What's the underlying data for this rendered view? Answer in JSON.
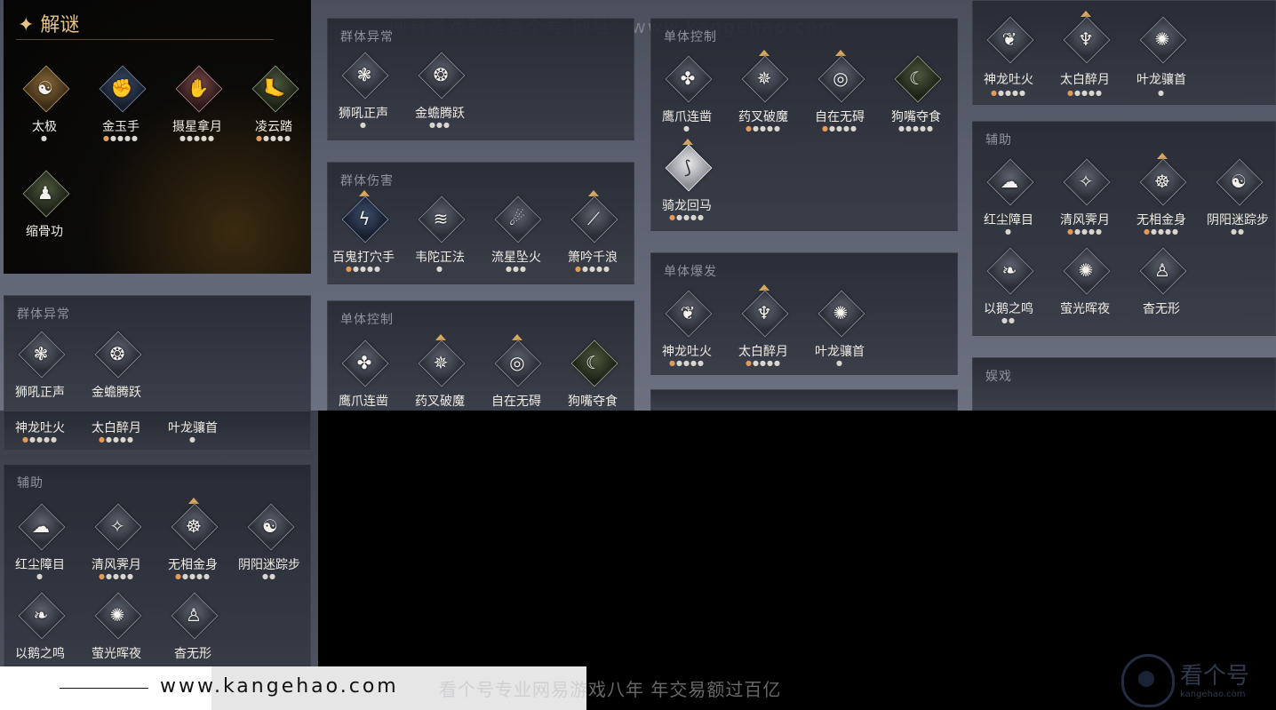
{
  "watermark_top": "网易游戏就选看个号   网址：www.kangehao.com",
  "header": {
    "title": "✦ 解谜"
  },
  "section_labels": {
    "group_abnormal": "群体异常",
    "group_damage": "群体伤害",
    "single_control": "单体控制",
    "single_burst": "单体爆发",
    "support": "辅助",
    "entertain": "娱戏"
  },
  "skills": {
    "taiji": {
      "name": "太极",
      "dots": "●",
      "orange": 0
    },
    "jinyushou": {
      "name": "金玉手",
      "dots": "●●●●●",
      "orange": 1
    },
    "zhexing": {
      "name": "摄星拿月",
      "dots": "●●●●●",
      "orange": 0
    },
    "lingyun": {
      "name": "凌云踏",
      "dots": "●●●●●",
      "orange": 1
    },
    "suogu": {
      "name": "缩骨功",
      "dots": "",
      "orange": 0
    },
    "shihou": {
      "name": "狮吼正声",
      "dots": "●",
      "orange": 0
    },
    "jinchan": {
      "name": "金蟾腾跃",
      "dots": "●●●",
      "orange": 0
    },
    "baigui": {
      "name": "百鬼打穴手",
      "dots": "●●●●●",
      "orange": 1
    },
    "weituo": {
      "name": "韦陀正法",
      "dots": "●",
      "orange": 0
    },
    "liuxing": {
      "name": "流星坠火",
      "dots": "●●●",
      "orange": 0
    },
    "xiaoyin": {
      "name": "箫吟千浪",
      "dots": "●●●●●",
      "orange": 1
    },
    "yingzhao": {
      "name": "鹰爪连凿",
      "dots": "●",
      "orange": 0
    },
    "yaocha": {
      "name": "药叉破魔",
      "dots": "●●●●●",
      "orange": 1
    },
    "zizai": {
      "name": "自在无碍",
      "dots": "●●●●●",
      "orange": 1
    },
    "goukou": {
      "name": "狗嘴夺食",
      "dots": "●●●●●",
      "orange": 0
    },
    "qilong": {
      "name": "骑龙回马",
      "dots": "●●●●●",
      "orange": 1
    },
    "shenlong": {
      "name": "神龙吐火",
      "dots": "●●●●●",
      "orange": 1
    },
    "taibai": {
      "name": "太白醉月",
      "dots": "●●●●●",
      "orange": 1
    },
    "yelong": {
      "name": "叶龙骧首",
      "dots": "●",
      "orange": 0
    },
    "hongchen": {
      "name": "红尘障目",
      "dots": "●",
      "orange": 0
    },
    "qingfeng": {
      "name": "清风霁月",
      "dots": "●●●●●",
      "orange": 1
    },
    "wuxiang": {
      "name": "无相金身",
      "dots": "●●●●●",
      "orange": 1
    },
    "yinyang": {
      "name": "阴阳迷踪步",
      "dots": "●●",
      "orange": 0
    },
    "yie": {
      "name": "以鹅之鸣",
      "dots": "●●",
      "orange": 0
    },
    "yingguang": {
      "name": "萤光晖夜",
      "dots": "",
      "orange": 0
    },
    "yaowuxing": {
      "name": "杳无形",
      "dots": "",
      "orange": 0
    }
  },
  "footer": {
    "site": "www.kangehao.com",
    "slogan": "看个号专业网易游戏八年   年交易额过百亿"
  },
  "logo": {
    "text": "看个号",
    "url": "kangehao.com"
  }
}
